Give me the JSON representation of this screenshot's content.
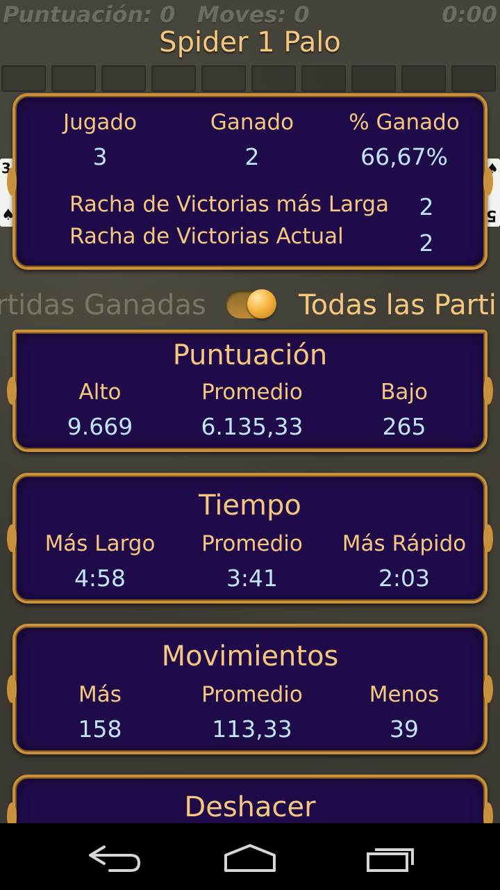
{
  "hud": {
    "score": "Puntuación: 0",
    "moves": "Moves: 0",
    "time": "0:00"
  },
  "game_title": "Spider 1 Palo",
  "side_cards": {
    "left_rank": "3",
    "left_suit": "♠",
    "right_rank": "5",
    "right_suit": "♠"
  },
  "summary": {
    "played_label": "Jugado",
    "played_value": "3",
    "won_label": "Ganado",
    "won_value": "2",
    "pct_label": "% Ganado",
    "pct_value": "66,67%",
    "longest_streak_label": "Racha de Victorias más Larga",
    "longest_streak_value": "2",
    "current_streak_label": "Racha de Victorias Actual",
    "current_streak_value": "2"
  },
  "filter": {
    "left_label": "rtidas Ganadas",
    "right_label": "Todas las Parti",
    "toggle_on": true
  },
  "score_panel": {
    "title": "Puntuación",
    "high_label": "Alto",
    "avg_label": "Promedio",
    "low_label": "Bajo",
    "high_value": "9.669",
    "avg_value": "6.135,33",
    "low_value": "265"
  },
  "time_panel": {
    "title": "Tiempo",
    "longest_label": "Más Largo",
    "avg_label": "Promedio",
    "fastest_label": "Más Rápido",
    "longest_value": "4:58",
    "avg_value": "3:41",
    "fastest_value": "2:03"
  },
  "moves_panel": {
    "title": "Movimientos",
    "most_label": "Más",
    "avg_label": "Promedio",
    "least_label": "Menos",
    "most_value": "158",
    "avg_value": "113,33",
    "least_value": "39"
  },
  "undo_panel": {
    "title": "Deshacer"
  },
  "navbar": {
    "back": "back-icon",
    "home": "home-icon",
    "recent": "recent-apps-icon"
  },
  "colors": {
    "panel_bg": "#200b4a",
    "border_gold": "#c9913b",
    "label_gold": "#f6c77f",
    "value_blue": "#bfe4f6"
  }
}
